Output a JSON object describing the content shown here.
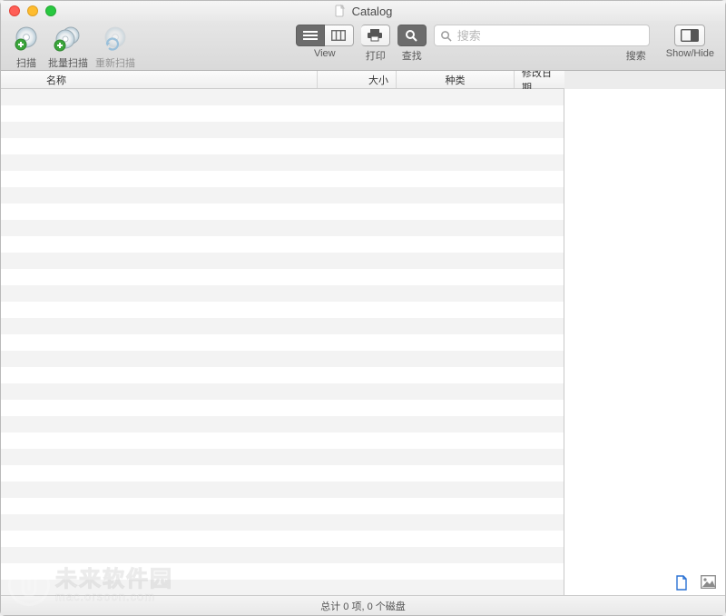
{
  "window": {
    "title": "Catalog"
  },
  "toolbar": {
    "scan_label": "扫描",
    "batch_scan_label": "批量扫描",
    "rescan_label": "重新扫描",
    "view_label": "View",
    "print_label": "打印",
    "find_label": "查找",
    "search_label": "搜索",
    "search_placeholder": "搜索",
    "showhide_label": "Show/Hide"
  },
  "columns": {
    "name": "名称",
    "size": "大小",
    "kind": "种类",
    "date": "修改日期"
  },
  "status": {
    "text": "总计 0 项, 0 个磁盘"
  },
  "watermark": {
    "line1": "未来软件园",
    "line2": "mac.orsoon.com"
  }
}
